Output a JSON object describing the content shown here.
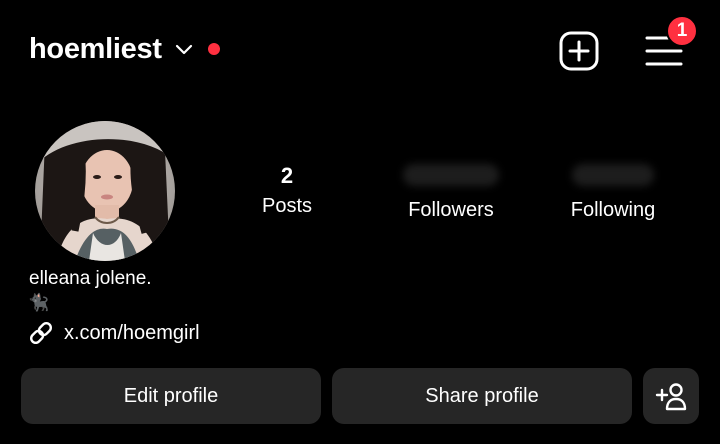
{
  "header": {
    "username": "hoemliest",
    "dropdown_icon": "chevron-down-icon",
    "status_dot_color": "#ff3040",
    "create_icon": "plus-square-icon",
    "menu_icon": "hamburger-menu-icon",
    "notification_count": "1"
  },
  "profile": {
    "avatar_icon": "profile-photo",
    "stats": {
      "posts": {
        "value": "2",
        "label": "Posts"
      },
      "followers": {
        "value": "",
        "label": "Followers"
      },
      "following": {
        "value": "",
        "label": "Following"
      }
    },
    "bio": {
      "name": "elleana jolene.",
      "emoji": "🐈‍⬛",
      "link_icon": "link-icon",
      "link": "x.com/hoemgirl"
    }
  },
  "actions": {
    "edit_label": "Edit profile",
    "share_label": "Share profile",
    "add_person_icon": "add-person-icon"
  },
  "colors": {
    "background": "#000000",
    "button_bg": "#262626",
    "accent_red": "#ff3040"
  }
}
